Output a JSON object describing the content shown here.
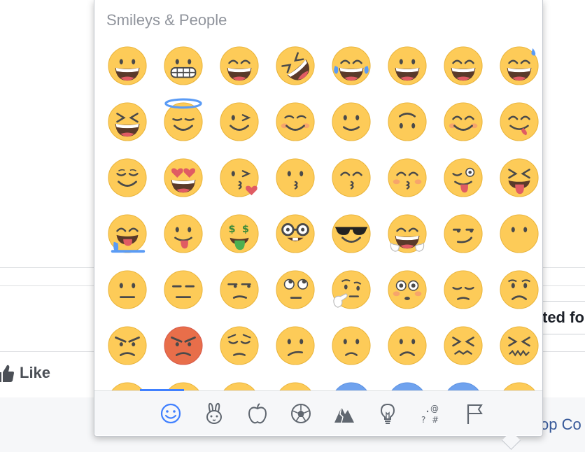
{
  "picker": {
    "section_title": "Smileys & People",
    "accent_color": "#4080ff",
    "emoji_rows": [
      [
        "grinning",
        "grimacing",
        "grin",
        "rofl",
        "joy",
        "smiley",
        "smile",
        "sweat-smile"
      ],
      [
        "laughing",
        "innocent",
        "wink",
        "blush",
        "slightly-smiling",
        "upside-down",
        "relaxed",
        "yum"
      ],
      [
        "relieved",
        "heart-eyes",
        "kissing-heart",
        "kissing",
        "kissing-smiling-eyes",
        "kissing-closed-eyes",
        "stuck-out-tongue-winking",
        "stuck-out-tongue-closed-eyes"
      ],
      [
        "drooling",
        "stuck-out-tongue",
        "money-mouth",
        "nerd",
        "sunglasses",
        "hugging",
        "smirk",
        "no-mouth"
      ],
      [
        "neutral",
        "expressionless",
        "unamused",
        "rolling-eyes",
        "thinking",
        "flushed",
        "disappointed",
        "worried"
      ],
      [
        "angry",
        "rage",
        "pensive",
        "confused",
        "slightly-frowning",
        "frowning",
        "persevere",
        "confounded"
      ],
      [
        "partial",
        "partial",
        "partial",
        "partial",
        "partial-blue",
        "partial-blue",
        "partial-blue",
        "partial"
      ]
    ],
    "categories": [
      {
        "icon": "smiley-category-icon",
        "active": true
      },
      {
        "icon": "animal-category-icon",
        "active": false
      },
      {
        "icon": "food-category-icon",
        "active": false
      },
      {
        "icon": "activity-category-icon",
        "active": false
      },
      {
        "icon": "travel-category-icon",
        "active": false
      },
      {
        "icon": "objects-category-icon",
        "active": false
      },
      {
        "icon": "symbols-category-icon",
        "active": false
      },
      {
        "icon": "flags-category-icon",
        "active": false
      }
    ]
  },
  "background": {
    "like_label": "Like",
    "right_box_text": "ted fo",
    "right_link_text": "op Co",
    "like_icon": "thumbs-up-icon"
  }
}
